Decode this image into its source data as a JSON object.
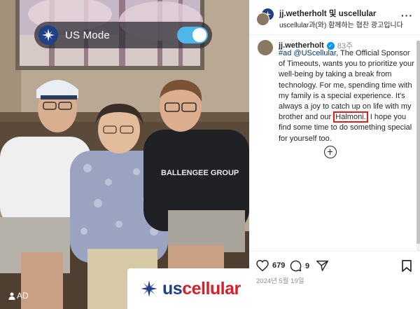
{
  "photo": {
    "mode_label": "US Mode",
    "mode_toggle_on": true,
    "brand": {
      "us": "us",
      "cellular": "cellular"
    },
    "ad_badge": "AD"
  },
  "header": {
    "title": "jj.wetherholt 및 uscellular",
    "subtitle": "uscellular과(와) 함께하는 협찬 광고입니다",
    "more_icon": "more-horizontal-icon"
  },
  "caption": {
    "username": "jj.wetherholt",
    "time_ago": "83주",
    "hashtag": "#ad",
    "mention": "@UScellular",
    "text_1": ", The Official Sponsor of Timeouts, wants you to prioritize your well-being by taking a break from technology. For me, spending time with my family is a special experience. It's always a joy to catch up on life with my brother and our ",
    "highlight": "Halmoni.",
    "text_2": " I hope you find some time to do something special for yourself too."
  },
  "actions": {
    "likes": "679",
    "comments": "9",
    "date": "2024년 5월 19일"
  },
  "colors": {
    "brand_blue": "#1f3f87",
    "brand_red": "#d61f2a",
    "toggle_blue": "#4fb7ea",
    "highlight_red": "#e01f1f",
    "link_blue": "#00376b"
  }
}
